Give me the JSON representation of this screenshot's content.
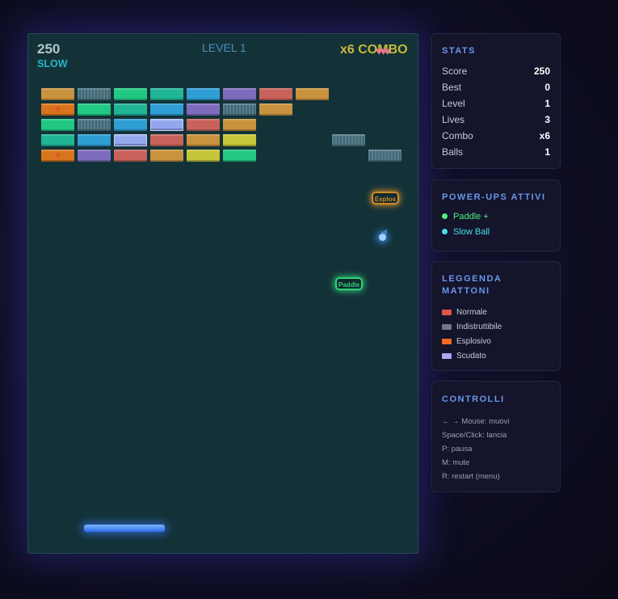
{
  "game": {
    "score": "250",
    "speed_status": "SLOW",
    "level_label": "LEVEL 1",
    "combo_label": "x6 COMBO",
    "hearts": "♥♥♥",
    "brick_colors": {
      "orange": "#c9923e",
      "teal": "#20b595",
      "green": "#22c884",
      "blue": "#2e9ed4",
      "purple": "#7d6cbe",
      "red": "#c8625a",
      "indestructible": "#4a7280",
      "explosive": "#d8751c",
      "shielded": "#93a6ee",
      "yellow": "#c7c53a"
    },
    "explosive_mark": "✲",
    "powerups_falling": [
      {
        "label": "Esplos",
        "color": "#d18b25"
      },
      {
        "label": "Paddle",
        "color": "#2fd078"
      }
    ]
  },
  "stats": {
    "title": "STATS",
    "rows": [
      {
        "label": "Score",
        "value": "250"
      },
      {
        "label": "Best",
        "value": "0"
      },
      {
        "label": "Level",
        "value": "1"
      },
      {
        "label": "Lives",
        "value": "3"
      },
      {
        "label": "Combo",
        "value": "x6"
      },
      {
        "label": "Balls",
        "value": "1"
      }
    ]
  },
  "powerups": {
    "title": "POWER-UPS ATTIVI",
    "items": [
      {
        "label": "Paddle +",
        "color": "#4ff085"
      },
      {
        "label": "Slow Ball",
        "color": "#49e0ef"
      }
    ]
  },
  "legend": {
    "title": "LEGGENDA MATTONI",
    "items": [
      {
        "label": "Normale",
        "color": "#e25548"
      },
      {
        "label": "Indistruttibile",
        "color": "#6d7c85"
      },
      {
        "label": "Esplosivo",
        "color": "#f26a1f"
      },
      {
        "label": "Scudato",
        "color": "#a9a6f5"
      }
    ]
  },
  "controls": {
    "title": "CONTROLLI",
    "lines": [
      "← → Mouse: muovi",
      "Space/Click: lancia",
      "P: pausa",
      "M: mute",
      "R: restart (menu)"
    ]
  }
}
